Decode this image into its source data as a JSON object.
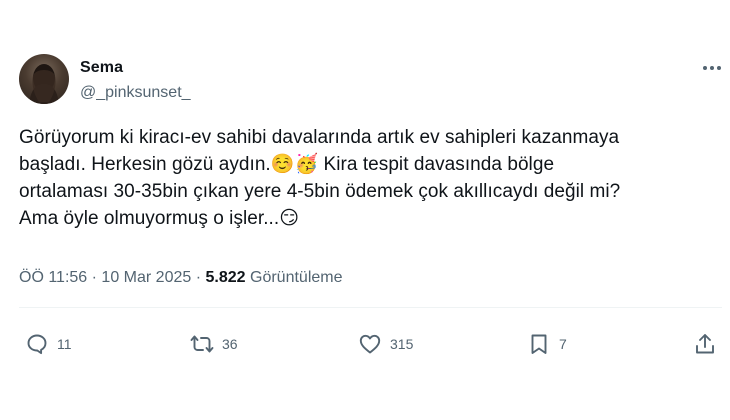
{
  "author": {
    "display_name": "Sema",
    "handle": "@_pinksunset_"
  },
  "tweet": {
    "text": "Görüyorum ki kiracı-ev sahibi davalarında artık ev sahipleri kazanmaya\nbaşladı. Herkesin gözü aydın.☺️🥳 Kira tespit davasında bölge\nortalaması 30-35bin çıkan yere 4-5bin ödemek çok akıllıcaydı değil mi?\nAma öyle olmuyormuş o işler...😏",
    "time": "ÖÖ 11:56",
    "separator": "·",
    "date": "10 Mar 2025",
    "views_count": "5.822",
    "views_label": "Görüntüleme"
  },
  "actions": {
    "reply_count": "11",
    "retweet_count": "36",
    "like_count": "315",
    "bookmark_count": "7"
  },
  "icons": {
    "reply": "reply-icon",
    "retweet": "retweet-icon",
    "like": "heart-icon",
    "bookmark": "bookmark-icon",
    "share": "share-icon",
    "more": "more-options-icon"
  },
  "colors": {
    "text": "#0f1419",
    "secondary": "#536471",
    "divider": "#eff3f4",
    "background": "#ffffff"
  }
}
